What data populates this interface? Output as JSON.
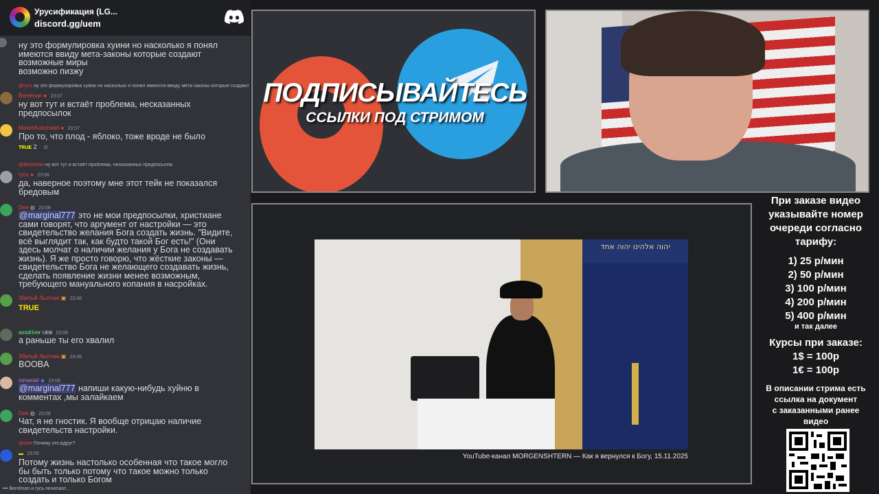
{
  "discord": {
    "server_name": "Урусификация (LG...",
    "invite": "discord.gg/uem"
  },
  "messages": [
    {
      "text": "ну это формулировка хуини но насколько я понял\nимеются ввиду мета-законы которые создают\nвозможные миры\nвозможно пизжу"
    },
    {
      "reply_user": "@гусь",
      "reply_text": "ну это формулировка хуйни но насколько я понял имеются ввиду мета-законы которые создают",
      "user": "Berelman",
      "time": "23:07",
      "text": "ну вот тут и встаёт проблема, несказанных\nпредпосылок"
    },
    {
      "user": "MaximKonchatel",
      "time": "23:07",
      "text": "Про то, что плод - яблоко, тоже вроде не было",
      "reaction_count": "2"
    },
    {
      "reply_user": "@Berelman",
      "reply_text": "ну вот тут и встаёт проблема, несказанных предпосылок",
      "user": "гусь",
      "time": "23:08",
      "text": "да, наверное поэтому мне этот тейк не показался\nбредовым"
    },
    {
      "user": "Dee",
      "time": "23:08",
      "mention": "@marginal777",
      "text": "это не мои предпосылки, христиане\nсами говорят, что аргумент от настройки — это\nсвидетельство желания Бога создать жизнь. \"Видите,\nвсё выглядит так, как будто такой Бог есть!\" (Они\nздесь молчат о наличии желания у Бога не создавать\nжизнь). Я же просто говорю, что жёсткие законы —\nсвидетельство Бога не желающего создавать жизнь,\nсделать появление жизни менее возможным,\nтребующего мануального копания в насройках."
    },
    {
      "user": "Збитый Льотчик",
      "time": "23:08",
      "text": "TRUE"
    },
    {
      "user": "assdriver",
      "badge": "UEB",
      "time": "23:08",
      "text": "а раньше ты его хвалил"
    },
    {
      "user": "Збитый Льотчик",
      "time": "23:08",
      "text": "BOOBA"
    },
    {
      "user": "minarski",
      "time": "23:08",
      "mention": "@marginal777",
      "text": "напиши какую-нибудь хуйню в\nкомментах ,мы залайкаем"
    },
    {
      "user": "Dee",
      "time": "23:09",
      "text": "Чат, я не гностик. Я вообще отрицаю наличие\nсвидетельств настройки."
    },
    {
      "reply_user": "@Dee",
      "reply_text": "Почему это вдруг?",
      "user": "",
      "time": "23:09",
      "text": "Потому жизнь настолько особенная что такое могло\nбы быть только потому что такое можно только\nсоздать и только Богом"
    }
  ],
  "typing": "Berelman и гусь печатают...",
  "promo": {
    "title": "ПОДПИСЫВАЙТЕСЬ",
    "subtitle": "ССЫЛКИ ПОД СТРИМОМ"
  },
  "video": {
    "caption": "YouTube-канал MORGENSHTERN — Как я вернулся к Богу, 15.11.2025",
    "ark_text": "יהוה אלהינו יהוה אחד"
  },
  "info": {
    "order_lines": [
      "При заказе видео",
      "указывайте номер",
      "очереди согласно",
      "тарифу:"
    ],
    "tariffs": [
      "1) 25 р/мин",
      "2) 50 р/мин",
      "3) 100 р/мин",
      "4) 200 р/мин",
      "5) 400 р/мин"
    ],
    "etc": "и так далее",
    "courses_title": "Курсы при заказе:",
    "courses": [
      "1$ = 100р",
      "1€ = 100р"
    ],
    "desc_lines": [
      "В описании стрима есть",
      "ссылка на документ",
      "с заказанными ранее",
      "видео"
    ]
  },
  "colors": {
    "chat_bg": "#313338",
    "header_bg": "#1e1f22",
    "username_red": "#f23f43",
    "username_green": "#57f287",
    "mention_bg": "#3c4270"
  }
}
